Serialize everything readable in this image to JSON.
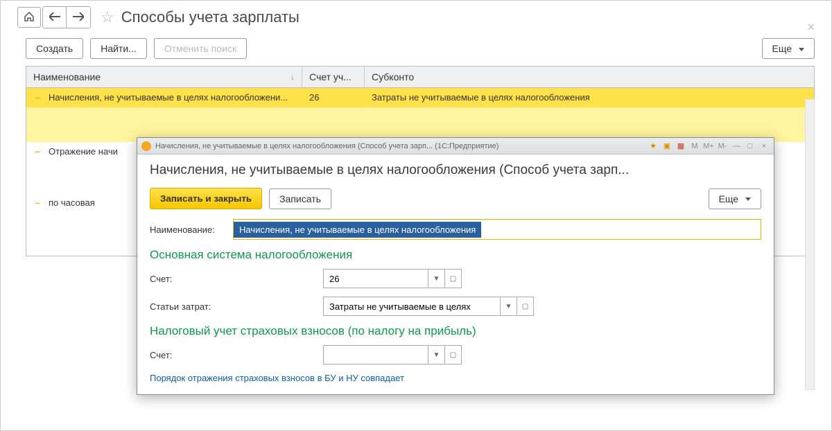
{
  "nav": {
    "home_icon": "home-icon",
    "back_icon": "arrow-left-icon",
    "forward_icon": "arrow-right-icon",
    "star_icon": "star-outline-icon"
  },
  "page": {
    "title": "Способы учета зарплаты",
    "close_icon": "close-icon"
  },
  "toolbar": {
    "create": "Создать",
    "find": "Найти...",
    "cancel_search": "Отменить поиск",
    "more": "Еще"
  },
  "grid": {
    "columns": {
      "name": "Наименование",
      "account": "Счет уч...",
      "subkonto": "Субконто"
    },
    "sort_indicator": "↓",
    "rows": [
      {
        "name": "Начисления, не учитываемые в целях налогообложени...",
        "account": "26",
        "subkonto": "Затраты не учитываемые в целях налогообложения",
        "selected": true
      },
      {
        "name": "Отражение начи",
        "account": "",
        "subkonto": "",
        "selected": false
      },
      {
        "name": "по часовая",
        "account": "",
        "subkonto": "",
        "selected": false
      }
    ]
  },
  "dialog": {
    "titlebar": "Начисления, не учитываемые в целях налогообложения (Способ учета зарп...   (1С:Предприятие)",
    "header": "Начисления, не учитываемые в целях налогообложения (Способ учета зарп...",
    "buttons": {
      "save_close": "Записать и закрыть",
      "save": "Записать",
      "more": "Еще"
    },
    "form": {
      "name_label": "Наименование:",
      "name_value": "Начисления, не учитываемые в целях налогообложения",
      "section_main": "Основная система налогообложения",
      "account_label": "Счет:",
      "account_value": "26",
      "cost_items_label": "Статьи затрат:",
      "cost_items_value": "Затраты не учитываемые в целях",
      "section_tax": "Налоговый учет страховых взносов (по налогу на прибыль)",
      "account2_label": "Счет:",
      "account2_value": "",
      "note": "Порядок отражения страховых взносов в БУ и НУ совпадает"
    }
  }
}
